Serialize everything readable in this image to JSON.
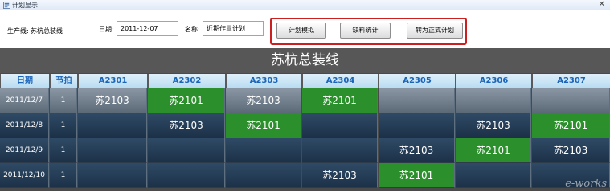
{
  "window": {
    "title": "计划显示",
    "close_glyph": "✕"
  },
  "toolbar": {
    "line_label": "生产线:",
    "line_value": "苏杭总装线",
    "date_label": "日期:",
    "date_value": "2011-12-07",
    "name_label": "名称:",
    "name_value": "近期作业计划",
    "buttons": {
      "simulate": "计划模拟",
      "shortage": "缺料统计",
      "formalize": "转为正式计划"
    }
  },
  "grid": {
    "title": "苏杭总装线",
    "columns": [
      "日期",
      "节拍",
      "A2301",
      "A2302",
      "A2303",
      "A2304",
      "A2305",
      "A2306",
      "A2307"
    ],
    "rows": [
      {
        "date": "2011/12/7",
        "beat": "1",
        "cells": [
          "苏2103",
          "苏2101",
          "苏2103",
          "苏2101",
          "",
          "",
          ""
        ]
      },
      {
        "date": "2011/12/8",
        "beat": "1",
        "cells": [
          "",
          "苏2103",
          "苏2101",
          "",
          "",
          "苏2103",
          "苏2101"
        ]
      },
      {
        "date": "2011/12/9",
        "beat": "1",
        "cells": [
          "",
          "",
          "",
          "",
          "苏2103",
          "苏2101",
          "苏2103"
        ]
      },
      {
        "date": "2011/12/10",
        "beat": "1",
        "cells": [
          "",
          "",
          "",
          "苏2103",
          "苏2101",
          "",
          ""
        ]
      }
    ],
    "cell_styles": [
      [
        "gray",
        "green",
        "gray",
        "green",
        "gray",
        "gray",
        "gray"
      ],
      [
        "navy",
        "navy",
        "green",
        "navy",
        "navy",
        "navy",
        "green"
      ],
      [
        "navy",
        "navy",
        "navy",
        "navy",
        "navy",
        "green",
        "navy"
      ],
      [
        "navy",
        "navy",
        "navy",
        "navy",
        "green",
        "navy",
        "navy"
      ]
    ]
  },
  "watermark": "e-works",
  "colors": {
    "highlight": "#cc1f1f",
    "header_text": "#1a64b8",
    "green_cell": "#2b8f2b",
    "navy_cell": "#1c3148"
  }
}
